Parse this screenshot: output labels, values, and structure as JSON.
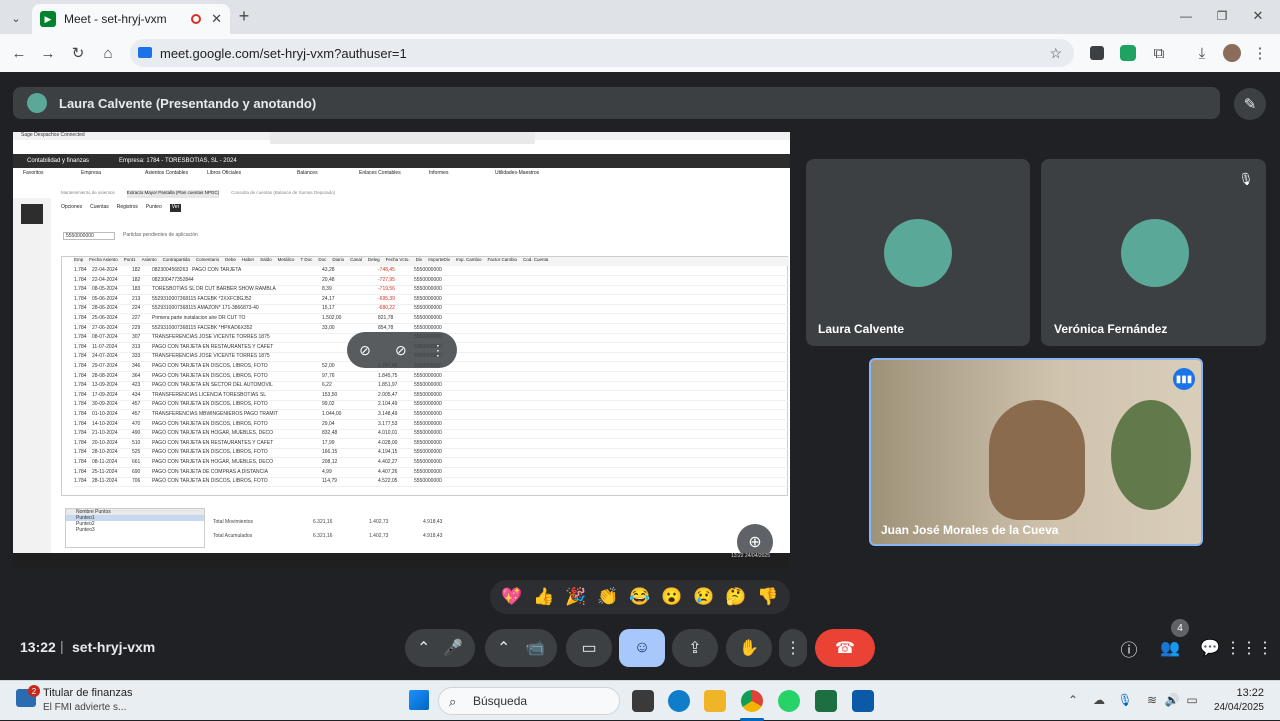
{
  "browser": {
    "tab_title": "Meet - set-hryj-vxm",
    "url": "meet.google.com/set-hryj-vxm?authuser=1"
  },
  "meet": {
    "presenter_label": "Laura Calvente (Presentando y anotando)",
    "participants": [
      {
        "name": "Laura Calvente"
      },
      {
        "name": "Verónica Fernández"
      },
      {
        "name": "Juan José Morales de la Cueva"
      }
    ],
    "time": "13:22",
    "meeting_code": "set-hryj-vxm",
    "participant_count": "4",
    "reactions": [
      "💖",
      "👍",
      "🎉",
      "👏",
      "😂",
      "😮",
      "😢",
      "🤔",
      "👎"
    ],
    "colors": {
      "end_call": "#ea4335",
      "active_reaction": "#a8c7fa",
      "accent": "#8ab4f8"
    }
  },
  "shared_screen": {
    "window_title": "Sage Despachos Connected",
    "company": "Empresa: 1784 - TORESBOTIAS, SL - 2024",
    "module": "Contabilidad y finanzas",
    "menu": [
      "Favoritos",
      "Empresa",
      "Asientos Contables",
      "Libros Oficiales",
      "Balances",
      "Enlaces Contables",
      "Informes",
      "Utilidades-Maestros"
    ],
    "tabs": [
      "Mantenimiento de asientos",
      "Extracto Mayor Pantalla (Plan cuentas NPGC)",
      "Consulta de cuentas (Balance de Sumas Depurado)"
    ],
    "submenu": [
      "Opciones",
      "Cuentas",
      "Registros",
      "Punteo",
      "Ver"
    ],
    "account": "5550000000",
    "account_desc": "Partidas pendientes de aplicación",
    "columns": [
      "Emp",
      "Fecha Asiento",
      "Punt1",
      "Asiento",
      "Contrapartida",
      "Comentario",
      "Debe",
      "Haber",
      "Saldo",
      "Metálico",
      "T Doc",
      "Doc",
      "Diario",
      "Canal",
      "Deleg",
      "Fecha Vcto.",
      "Div",
      "ImporteDiv",
      "Imp. Cambio",
      "Factor Cambio",
      "Cod. Cuenta"
    ],
    "rows": [
      [
        "1.784",
        "22-04-2024",
        "182",
        "0823004568263",
        "PAGO CON TARJETA",
        "43,28",
        "",
        "-748,45",
        "5550000000"
      ],
      [
        "1.784",
        "22-04-2024",
        "182",
        "082300477352844",
        "",
        "20,48",
        "",
        "-727,95",
        "5550000000"
      ],
      [
        "1.784",
        "08-05-2024",
        "183",
        "TORESBOTIAS SL DR CUT BARBER SHOW RAMBLA",
        "",
        "8,39",
        "",
        "-719,56",
        "5550000000"
      ],
      [
        "1.784",
        "05-06-2024",
        "213",
        "5529310007368115 FACEBK *2XXFC8GJ52",
        "",
        "24,17",
        "",
        "-695,39",
        "5550000000"
      ],
      [
        "1.784",
        "28-06-2024",
        "224",
        "5529310007368115 AMAZON* 171-3866873-40",
        "",
        "15,17",
        "",
        "-680,22",
        "5550000000"
      ],
      [
        "1.784",
        "25-06-2024",
        "227",
        "Primera parte instalacion aire DR CUT TO",
        "",
        "1.502,00",
        "",
        "821,78",
        "5550000000"
      ],
      [
        "1.784",
        "27-06-2024",
        "229",
        "5529310007368115 FACEBK *HPKAD6X352",
        "",
        "33,00",
        "",
        "854,78",
        "5550000000"
      ],
      [
        "1.784",
        "08-07-2024",
        "307",
        "TRANSFERENCIAS JOSE VICENTE TORRES 1875",
        "",
        "",
        "",
        "",
        "5550000000"
      ],
      [
        "1.784",
        "11-07-2024",
        "313",
        "PAGO CON TARJETA EN RESTAURANTES Y CAFET",
        "",
        "",
        "",
        "",
        "5550000000"
      ],
      [
        "1.784",
        "24-07-2024",
        "333",
        "TRANSFERENCIAS JOSE VICENTE TORRES 1875",
        "",
        "",
        "",
        "",
        "5550000000"
      ],
      [
        "1.784",
        "29-07-2024",
        "346",
        "PAGO CON TARJETA EN DISCOS, LIBROS, FOTO",
        "",
        "52,00",
        "",
        "1.747,99",
        "5550000000"
      ],
      [
        "1.784",
        "28-08-2024",
        "364",
        "PAGO CON TARJETA EN DISCOS, LIBROS, FOTO",
        "",
        "97,76",
        "",
        "1.845,75",
        "5550000000"
      ],
      [
        "1.784",
        "13-09-2024",
        "423",
        "PAGO CON TARJETA EN SECTOR DEL AUTOMOVIL",
        "",
        "6,22",
        "",
        "1.851,97",
        "5550000000"
      ],
      [
        "1.784",
        "17-09-2024",
        "434",
        "TRANSFERENCIAS LICENCIA TORESBOTIAS SL",
        "",
        "153,50",
        "",
        "2.005,47",
        "5550000000"
      ],
      [
        "1.784",
        "30-09-2024",
        "457",
        "PAGO CON TARJETA EN DISCOS, LIBROS, FOTO",
        "",
        "99,02",
        "",
        "2.104,49",
        "5550000000"
      ],
      [
        "1.784",
        "01-10-2024",
        "457",
        "TRANSFERENCIAS MBWINGENIEROS PAGO TRAMIT",
        "",
        "1.044,00",
        "",
        "3.148,49",
        "5550000000"
      ],
      [
        "1.784",
        "14-10-2024",
        "470",
        "PAGO CON TARJETA EN DISCOS, LIBROS, FOTO",
        "",
        "29,04",
        "",
        "3.177,53",
        "5550000000"
      ],
      [
        "1.784",
        "21-10-2024",
        "490",
        "PAGO CON TARJETA EN HOGAR, MUEBLES, DECO",
        "",
        "832,48",
        "",
        "4.010,01",
        "5550000000"
      ],
      [
        "1.784",
        "20-10-2024",
        "510",
        "PAGO CON TARJETA EN RESTAURANTES Y CAFET",
        "",
        "17,99",
        "",
        "4.028,00",
        "5550000000"
      ],
      [
        "1.784",
        "28-10-2024",
        "525",
        "PAGO CON TARJETA EN DISCOS, LIBROS, FOTO",
        "",
        "166,15",
        "",
        "4.194,15",
        "5550000000"
      ],
      [
        "1.784",
        "08-11-2024",
        "661",
        "PAGO CON TARJETA EN HOGAR, MUEBLES, DECO",
        "",
        "208,12",
        "",
        "4.402,27",
        "5550000000"
      ],
      [
        "1.784",
        "25-11-2024",
        "690",
        "PAGO CON TARJETA DE COMPRAS A DISTANCIA",
        "",
        "4,99",
        "",
        "4.407,26",
        "5550000000"
      ],
      [
        "1.784",
        "28-11-2024",
        "706",
        "PAGO CON TARJETA EN DISCOS, LIBROS, FOTO",
        "",
        "114,79",
        "",
        "4.522,05",
        "5550000000"
      ]
    ],
    "totals": {
      "puntos_header": "Nombre Puntos",
      "puntos": [
        "Punteo1",
        "Punteo2",
        "Punteo3"
      ],
      "total_movimientos": "Total Movimientos",
      "total_acumulados": "Total Acumulados",
      "debe": "6.321,16",
      "haber": "1.402,73",
      "saldo": "4.918,43"
    },
    "clock": "13:22",
    "date": "24/04/2025"
  },
  "taskbar": {
    "notification_title": "Titular de finanzas",
    "notification_text": "El FMI advierte s...",
    "notification_badge": "2",
    "search_placeholder": "Búsqueda",
    "time": "13:22",
    "date": "24/04/2025"
  }
}
